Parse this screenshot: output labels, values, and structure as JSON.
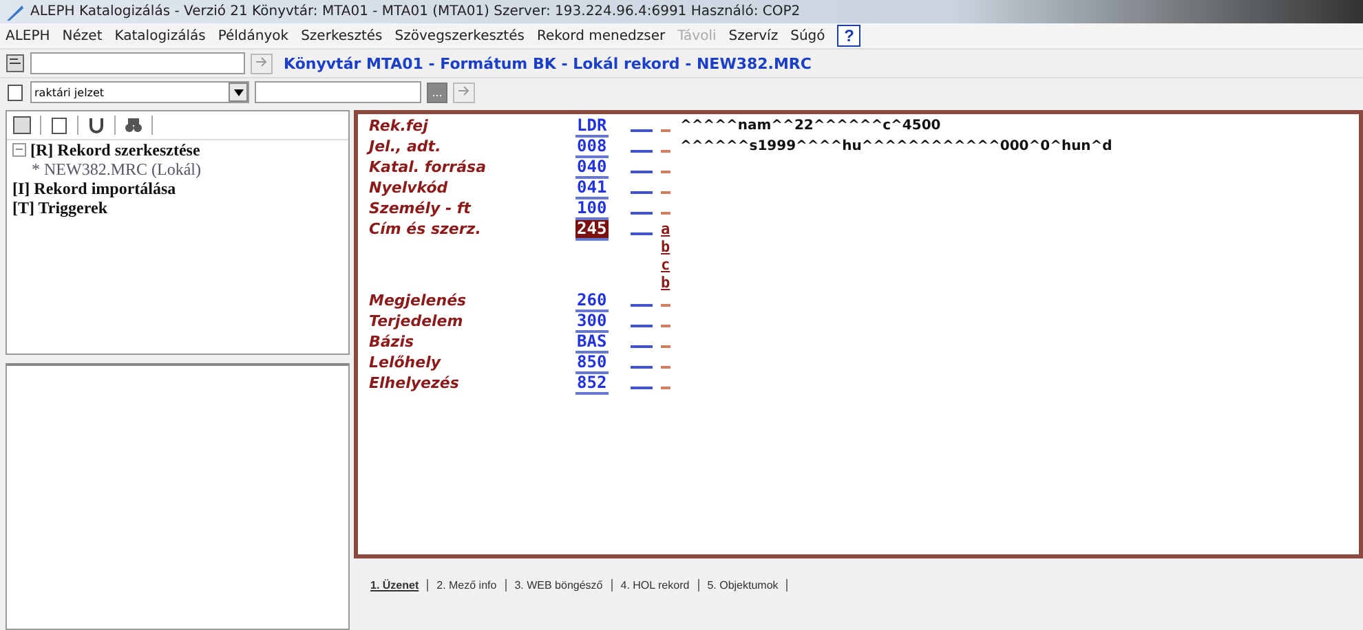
{
  "window": {
    "title": "ALEPH Katalogizálás - Verzió 21  Könyvtár: MTA01 - MTA01 (MTA01)  Szerver: 193.224.96.4:6991  Használó: COP2"
  },
  "menu": [
    {
      "label": "ALEPH",
      "disabled": false
    },
    {
      "label": "Nézet",
      "disabled": false
    },
    {
      "label": "Katalogizálás",
      "disabled": false
    },
    {
      "label": "Példányok",
      "disabled": false
    },
    {
      "label": "Szerkesztés",
      "disabled": false
    },
    {
      "label": "Szövegszerkesztés",
      "disabled": false
    },
    {
      "label": "Rekord menedzser",
      "disabled": false
    },
    {
      "label": "Távoli",
      "disabled": true
    },
    {
      "label": "Szervíz",
      "disabled": false
    },
    {
      "label": "Súgó",
      "disabled": false
    }
  ],
  "help_button": "?",
  "toolbar": {
    "record_title": "Könyvtár MTA01 - Formátum BK - Lokál rekord - NEW382.MRC",
    "index_select": "raktári jelzet",
    "browse_button": "..."
  },
  "tree": [
    {
      "label": "[R] Rekord szerkesztése",
      "expanded": true,
      "children": [
        {
          "label": "* NEW382.MRC (Lokál)"
        }
      ]
    },
    {
      "label": "[I] Rekord importálása"
    },
    {
      "label": "[T] Triggerek"
    }
  ],
  "expander": "−",
  "fields": [
    {
      "label": "Rek.fej",
      "tag": "LDR",
      "selected": false,
      "content": "^^^^^nam^^22^^^^^^c^4500"
    },
    {
      "label": "Jel., adt.",
      "tag": "008",
      "selected": false,
      "content": "^^^^^^s1999^^^^hu^^^^^^^^^^^^000^0^hun^d"
    },
    {
      "label": "Katal. forrása",
      "tag": "040",
      "selected": false
    },
    {
      "label": "Nyelvkód",
      "tag": "041",
      "selected": false
    },
    {
      "label": "Személy - ft",
      "tag": "100",
      "selected": false
    },
    {
      "label": "Cím és szerz.",
      "tag": "245",
      "selected": true,
      "subfields": [
        "a",
        "b",
        "c",
        "b"
      ]
    },
    {
      "label": "Megjelenés",
      "tag": "260",
      "selected": false
    },
    {
      "label": "Terjedelem",
      "tag": "300",
      "selected": false
    },
    {
      "label": "Bázis",
      "tag": "BAS",
      "selected": false
    },
    {
      "label": "Lelőhely",
      "tag": "850",
      "selected": false
    },
    {
      "label": "Elhelyezés",
      "tag": "852",
      "selected": false
    }
  ],
  "bottom_tabs": [
    {
      "label": "1. Üzenet",
      "selected": true
    },
    {
      "label": "2. Mező info",
      "selected": false
    },
    {
      "label": "3. WEB böngésző",
      "selected": false
    },
    {
      "label": "4. HOL rekord",
      "selected": false
    },
    {
      "label": "5. Objektumok",
      "selected": false
    }
  ]
}
